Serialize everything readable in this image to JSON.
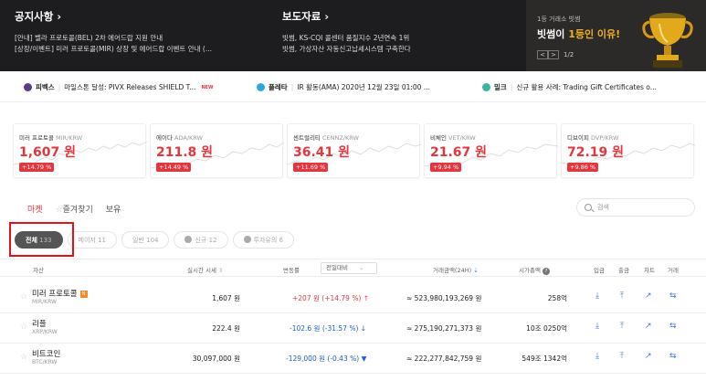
{
  "banner": {
    "notice": {
      "title": "공지사항",
      "lines": [
        "[안내] 벨라 프로토콜(BEL) 2차 에어드랍 지원 안내",
        "[상장/이벤트] 미러 프로토콜(MIR) 상장 및 에어드랍 이벤트 안내 (..."
      ]
    },
    "press": {
      "title": "보도자료",
      "lines": [
        "빗썸, KS-CQI 콜센터 품질지수 2년연속 1위",
        "빗썸, 가상자산 자동신고납세시스템 구축한다"
      ]
    },
    "promo": {
      "small": "1등 거래소 빗썸",
      "big_prefix": "빗썸이 ",
      "big_highlight": "1등인 이유!",
      "page": "1/2",
      "prev": "<",
      "next": ">"
    }
  },
  "news": [
    {
      "name": "피벡스",
      "text": "마일스톤 달성: PIVX Releases SHIELD T...",
      "new": "NEW",
      "color": "#5b3c88"
    },
    {
      "name": "플레타",
      "text": "IR 활동(AMA) 2020년 12월 23일 01:00 ...",
      "new": "",
      "color": "#2aa9e0"
    },
    {
      "name": "밀크",
      "text": "신규 활용 사례: Trading Gift Certificates o...",
      "new": "",
      "color": "#3cb4a0"
    }
  ],
  "cards": [
    {
      "name": "미러 프로토콜",
      "pair": "MIR/KRW",
      "price": "1,607 원",
      "change": "+14.79 %"
    },
    {
      "name": "에이다",
      "pair": "ADA/KRW",
      "price": "211.8 원",
      "change": "+14.49 %"
    },
    {
      "name": "센트럴리티",
      "pair": "CENNZ/KRW",
      "price": "36.41 원",
      "change": "+11.69 %"
    },
    {
      "name": "비체인",
      "pair": "VET/KRW",
      "price": "21.67 원",
      "change": "+9.94 %"
    },
    {
      "name": "디브이피",
      "pair": "DVP/KRW",
      "price": "72.19 원",
      "change": "+9.86 %"
    }
  ],
  "tabs": {
    "market": "마켓",
    "favorites": "즐겨찾기",
    "holdings": "보유"
  },
  "search": {
    "placeholder": "검색"
  },
  "filters": [
    {
      "label": "전체",
      "count": "133"
    },
    {
      "label": "메이저",
      "count": "11"
    },
    {
      "label": "일반",
      "count": "104"
    },
    {
      "label": "신규",
      "count": "12"
    },
    {
      "label": "투자유의",
      "count": "6"
    }
  ],
  "table": {
    "headers": {
      "asset": "자산",
      "price": "실시간 시세",
      "change": "변동률",
      "basis": "전일대비",
      "volume": "거래금액(24H)",
      "mcap": "시가총액",
      "deposit": "입금",
      "withdraw": "출금",
      "chart": "차트",
      "trade": "거래"
    },
    "rows": [
      {
        "name": "미러 프로토콜",
        "pair": "MIR/KRW",
        "badge": "N",
        "price": "1,607 원",
        "change": "+207 원 (+14.79 %)",
        "arrow": "↑",
        "volume": "≈ 523,980,193,269 원",
        "mcap": "258억",
        "dir": "up"
      },
      {
        "name": "리플",
        "pair": "XRP/KRW",
        "badge": "",
        "price": "222.4 원",
        "change": "-102.6 원 (-31.57 %)",
        "arrow": "↓",
        "volume": "≈ 275,190,271,373 원",
        "mcap": "10조 0250억",
        "dir": "dn"
      },
      {
        "name": "비트코인",
        "pair": "BTC/KRW",
        "badge": "",
        "price": "30,097,000 원",
        "change": "-129,000 원 (-0.43 %)",
        "arrow": "▼",
        "volume": "≈ 222,277,842,759 원",
        "mcap": "549조 1342억",
        "dir": "dn"
      }
    ]
  }
}
